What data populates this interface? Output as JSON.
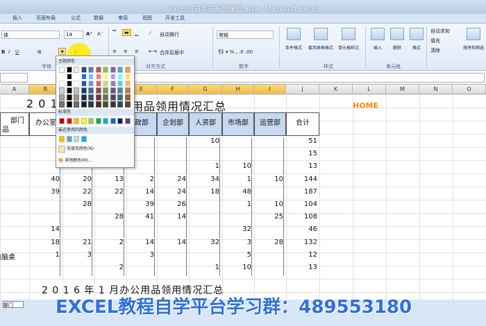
{
  "window": {
    "title": "Excel小白到白系列课程.xlsx - Microsoft Excel"
  },
  "tabs": [
    "插入",
    "页面布局",
    "公式",
    "数据",
    "审阅",
    "视图",
    "开发工具"
  ],
  "ribbon": {
    "font_name": "体",
    "font_size": "14",
    "wrap_text": "自动换行",
    "merge_center": "合并后居中",
    "number_format": "常规",
    "groups": {
      "font": "字体",
      "alignment": "对齐方式",
      "number": "数字",
      "styles": "样式",
      "cells": "单元格"
    },
    "buttons": {
      "conditional": "条件格式",
      "table_format": "套用表格格式",
      "cell_styles": "单元格样式",
      "insert": "插入",
      "delete": "删除",
      "format": "格式",
      "autosum": "自动求和",
      "fill": "填充",
      "clear": "清除",
      "sort_filter": "排序和筛选"
    }
  },
  "palette": {
    "theme_label": "主题颜色",
    "standard_label": "标准色",
    "recent_label": "最近使用的颜色",
    "no_fill": "无填充颜色(N)",
    "more": "其他颜色(M)...",
    "theme_colors": [
      "#ffffff",
      "#000000",
      "#eeece1",
      "#1f497d",
      "#4f81bd",
      "#c0504d",
      "#9bbb59",
      "#8064a2",
      "#4bacc6",
      "#f79646"
    ],
    "standard_colors": [
      "#c00000",
      "#ff0000",
      "#ffc000",
      "#ffff00",
      "#92d050",
      "#00b050",
      "#00b0f0",
      "#0070c0",
      "#002060",
      "#7030a0"
    ],
    "recent_colors": [
      "#ffc000",
      "#4bacc6",
      "#b7dde8",
      "#00b0f0"
    ],
    "accent_no_fill": "#f7e7a3"
  },
  "columns": [
    "A",
    "B",
    "C",
    "D",
    "E",
    "F",
    "G",
    "H",
    "I",
    "J",
    "K",
    "L",
    "M",
    "N",
    "O"
  ],
  "sheet": {
    "title": "2 0 1",
    "title_tail": "用品领用情况汇总",
    "subtitle": "2 0 1 6 年 1 月办公用品领用情况汇总",
    "header_dept_top": "部门",
    "header_dept_bottom": "品",
    "headers": [
      "办公室",
      "",
      "",
      "政部",
      "企划部",
      "人资部",
      "市场部",
      "运营部"
    ],
    "total_label": "合计",
    "row_label": "电脑桌",
    "rows": [
      [
        "",
        "",
        "",
        "",
        "",
        "10",
        "",
        "",
        "51"
      ],
      [
        "",
        "",
        "",
        "",
        "",
        "",
        "",
        "",
        "15"
      ],
      [
        "",
        "",
        "",
        "",
        "",
        "1",
        "10",
        "",
        "13"
      ],
      [
        "40",
        "20",
        "13",
        "2",
        "24",
        "34",
        "1",
        "10",
        "144"
      ],
      [
        "39",
        "22",
        "22",
        "14",
        "24",
        "18",
        "48",
        "",
        "187"
      ],
      [
        "",
        "28",
        "",
        "39",
        "26",
        "",
        "1",
        "10",
        "104"
      ],
      [
        "",
        "",
        "28",
        "41",
        "14",
        "",
        "",
        "25",
        "108"
      ],
      [
        "14",
        "",
        "",
        "",
        "",
        "",
        "32",
        "",
        "46"
      ],
      [
        "18",
        "21",
        "2",
        "14",
        "14",
        "32",
        "3",
        "28",
        "132"
      ],
      [
        "1",
        "3",
        "",
        "3",
        "",
        "",
        "5",
        "",
        "12"
      ],
      [
        "",
        "",
        "2",
        "",
        "",
        "1",
        "10",
        "",
        "13"
      ]
    ]
  },
  "watermark": "HOME",
  "banner": "EXCEL教程自学平台学习群：489553180"
}
